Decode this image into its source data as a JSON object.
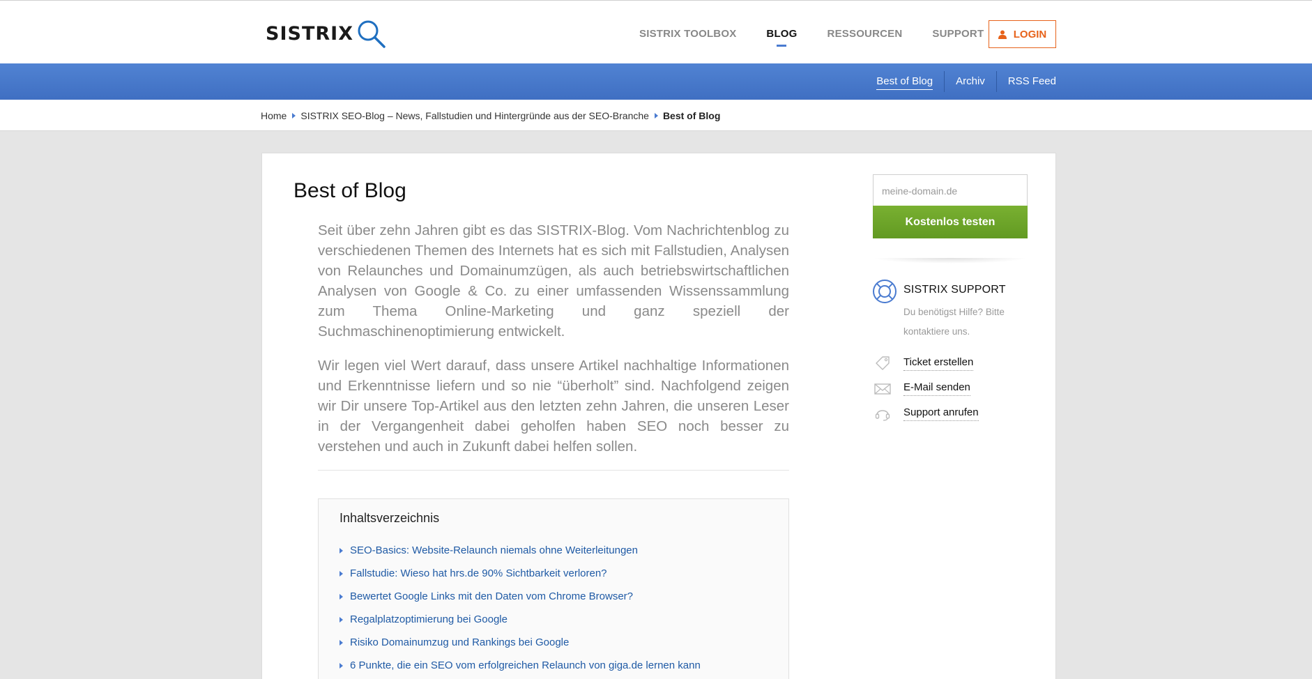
{
  "header": {
    "logo_text": "SISTRIX",
    "nav": [
      "SISTRIX TOOLBOX",
      "BLOG",
      "RESSOURCEN",
      "SUPPORT"
    ],
    "login_label": "LOGIN"
  },
  "subnav": {
    "items": [
      "Best of Blog",
      "Archiv",
      "RSS Feed"
    ]
  },
  "breadcrumb": {
    "items": [
      "Home",
      "SISTRIX SEO-Blog – News, Fallstudien und Hintergründe aus der SEO-Branche"
    ],
    "current": "Best of Blog"
  },
  "main": {
    "title": "Best of Blog",
    "paragraph1": "Seit über zehn Jahren gibt es das SISTRIX-Blog. Vom Nachrichtenblog zu verschiedenen Themen des Internets hat es sich mit Fallstudien, Analysen von Relaunches und Domainumzügen, als auch betriebswirtschaftlichen Analysen von Google & Co. zu einer umfassenden Wissenssammlung zum Thema Online-Marketing und ganz speziell der Suchmaschinenoptimierung entwickelt.",
    "paragraph2": "Wir legen viel Wert darauf, dass unsere Artikel nachhaltige Informationen und Erkenntnisse liefern und so nie “überholt” sind. Nachfolgend zeigen wir Dir unsere Top-Artikel aus den letzten zehn Jahren, die unseren Leser in der Vergangenheit dabei geholfen haben SEO noch besser zu verstehen und auch in Zukunft dabei helfen sollen.",
    "toc": {
      "title": "Inhaltsverzeichnis",
      "items": [
        "SEO-Basics: Website-Relaunch niemals ohne Weiterleitungen",
        "Fallstudie: Wieso hat hrs.de 90% Sichtbarkeit verloren?",
        "Bewertet Google Links mit den Daten vom Chrome Browser?",
        "Regalplatzoptimierung bei Google",
        "Risiko Domainumzug und Rankings bei Google",
        "6 Punkte, die ein SEO vom erfolgreichen Relaunch von giga.de lernen kann"
      ]
    }
  },
  "sidebar": {
    "domain_placeholder": "meine-domain.de",
    "test_button": "Kostenlos testen",
    "support_title": "SISTRIX SUPPORT",
    "support_desc": "Du benötigst Hilfe? Bitte kontaktiere uns.",
    "links": [
      "Ticket erstellen",
      "E-Mail senden",
      "Support anrufen"
    ]
  },
  "colors": {
    "accent_blue": "#4a7bd0",
    "login_orange": "#e7621a",
    "cta_green": "#6ea42a"
  }
}
